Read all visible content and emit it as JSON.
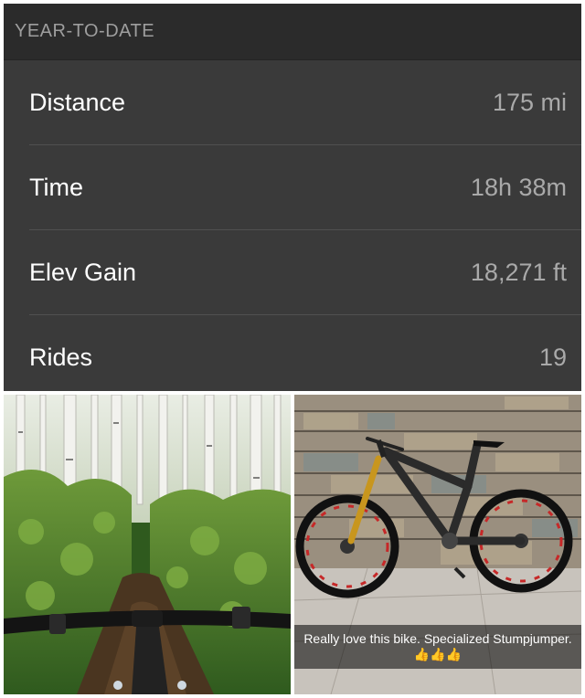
{
  "stats": {
    "header": "YEAR-TO-DATE",
    "rows": [
      {
        "label": "Distance",
        "value": "175 mi"
      },
      {
        "label": "Time",
        "value": "18h 38m"
      },
      {
        "label": "Elev Gain",
        "value": "18,271 ft"
      },
      {
        "label": "Rides",
        "value": "19"
      }
    ]
  },
  "photos": {
    "bike_caption": "Really love this bike. Specialized Stumpjumper.",
    "bike_caption_emoji": "👍👍👍"
  }
}
